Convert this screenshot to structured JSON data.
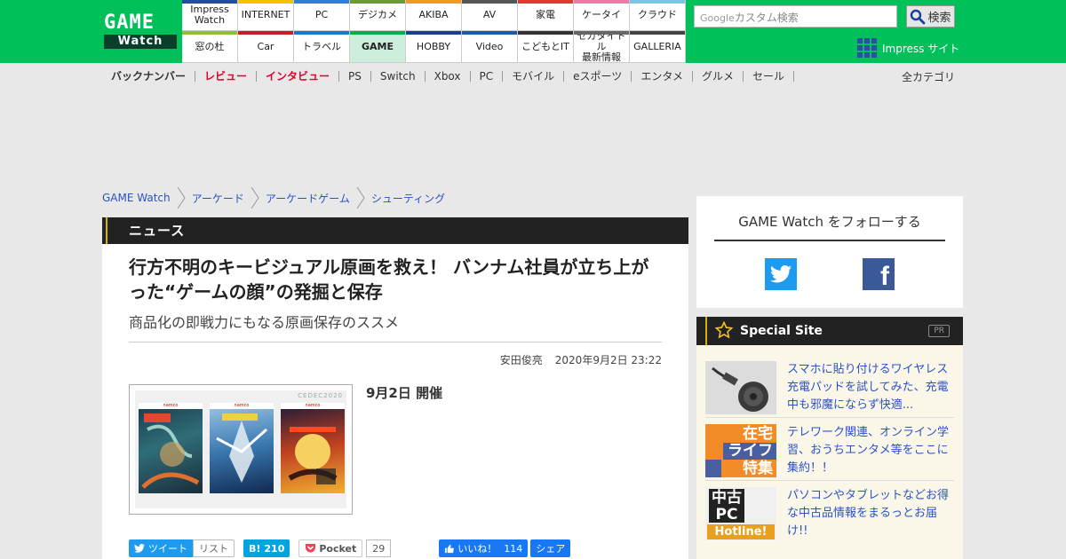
{
  "header": {
    "logo_top": "GAME",
    "logo_bottom": "Watch",
    "sites_row1": [
      {
        "label": "Impress\nWatch",
        "color": "#1e4fa3"
      },
      {
        "label": "INTERNET",
        "color": "#f2c400"
      },
      {
        "label": "PC",
        "color": "#2e7fd9"
      },
      {
        "label": "デジカメ",
        "color": "#6a9b3a"
      },
      {
        "label": "AKIBA",
        "color": "#f29a1e"
      },
      {
        "label": "AV",
        "color": "#555555"
      },
      {
        "label": "家電",
        "color": "#e23a2f"
      },
      {
        "label": "ケータイ",
        "color": "#f07aa6"
      },
      {
        "label": "クラウド",
        "color": "#7cc3e8"
      }
    ],
    "sites_row2": [
      {
        "label": "窓の杜",
        "color": "#8fbf3a"
      },
      {
        "label": "Car",
        "color": "#c0202a"
      },
      {
        "label": "トラベル",
        "color": "#1b7ac8"
      },
      {
        "label": "GAME",
        "color": "#00b050",
        "active": true
      },
      {
        "label": "HOBBY",
        "color": "#1c3f8a"
      },
      {
        "label": "Video",
        "color": "#1d5aa6"
      },
      {
        "label": "こどもとIT",
        "color": "#333333"
      },
      {
        "label": "セガタイトル\n最新情報",
        "color": "#666666"
      },
      {
        "label": "GALLERIA",
        "color": "#444444"
      }
    ],
    "search_placeholder": "カスタム検索",
    "search_google": "Google",
    "search_button": "検索",
    "impress_site": "Impress サイト"
  },
  "nav": {
    "items": [
      {
        "label": "バックナンバー",
        "style": "bold"
      },
      {
        "label": "レビュー",
        "style": "red"
      },
      {
        "label": "インタビュー",
        "style": "red"
      },
      {
        "label": "PS",
        "style": ""
      },
      {
        "label": "Switch",
        "style": ""
      },
      {
        "label": "Xbox",
        "style": ""
      },
      {
        "label": "PC",
        "style": ""
      },
      {
        "label": "モバイル",
        "style": ""
      },
      {
        "label": "eスポーツ",
        "style": ""
      },
      {
        "label": "エンタメ",
        "style": ""
      },
      {
        "label": "グルメ",
        "style": ""
      },
      {
        "label": "セール",
        "style": ""
      }
    ],
    "all_categories": "全カテゴリ"
  },
  "breadcrumb": [
    "GAME Watch",
    "アーケード",
    "アーケードゲーム",
    "シューティング"
  ],
  "article": {
    "section": "ニュース",
    "title": "行方不明のキービジュアル原画を救え！ バンナム社員が立ち上がった“ゲームの顔”の発掘と保存",
    "subtitle": "商品化の即戦力にもなる原画保存のススメ",
    "author": "安田俊亮",
    "date": "2020年9月2日 23:22",
    "event_date": "9月2日 開催",
    "photo_brand": "CEDEC2020",
    "cover_maker": "namco"
  },
  "share": {
    "tweet": "ツイート",
    "list": "リスト",
    "hatena_count": "210",
    "pocket": "Pocket",
    "pocket_count": "29",
    "fb_like": "いいね！",
    "fb_like_count": "114",
    "fb_share": "シェア"
  },
  "sidebar": {
    "follow_title": "GAME Watch をフォローする",
    "special_title": "Special Site",
    "pr": "PR",
    "items": [
      {
        "text": "スマホに貼り付けるワイヤレス充電パッドを試してみた、充電中も邪魔にならず快適..."
      },
      {
        "text": "テレワーク関連、オンライン学習、おうちエンタメ等をここに集約！！",
        "thumb_lines": [
          "在宅",
          "ライフ",
          "特集"
        ]
      },
      {
        "text": "パソコンやタブレットなどお得な中古品情報をまるっとお届け!!",
        "thumb_lines": [
          "中古",
          "PC",
          "Hotline!"
        ]
      }
    ]
  },
  "colors": {
    "brand_green": "#00c05a",
    "link_blue": "#2a52c8",
    "accent_red": "#e0002a"
  }
}
